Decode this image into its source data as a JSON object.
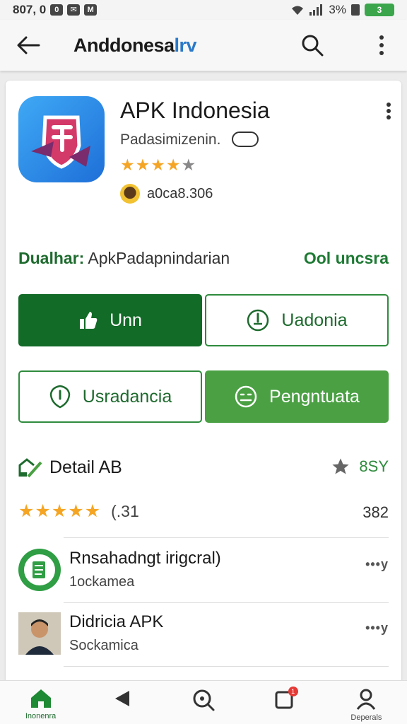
{
  "status_bar": {
    "time": "807, 0",
    "battery": "3%",
    "battery_pill": "3"
  },
  "app_bar": {
    "title_main": "Anddonesa",
    "title_accent": "lrv"
  },
  "app": {
    "name": "APK Indonesia",
    "developer": "Padasimizenin.",
    "rating_stars": 4,
    "downloads": "a0ca8.306"
  },
  "info": {
    "label_bold": "Dualhar:",
    "label_rest": "ApkPadapnindarian",
    "link": "Ool uncsra"
  },
  "buttons": [
    {
      "label": "Unn",
      "icon": "thumbs-up-icon"
    },
    {
      "label": "Uadonia",
      "icon": "download-circle-icon"
    },
    {
      "label": "Usradancia",
      "icon": "shield-icon"
    },
    {
      "label": "Pengntuata",
      "icon": "emoji-icon"
    }
  ],
  "details": {
    "title": "Detail AB",
    "right_label": "8SY",
    "rating_stars": 5,
    "rating_count": "(.31",
    "rating_right": "382"
  },
  "reviews": [
    {
      "name": "Rnsahadngt irigcral)",
      "sub": "1ockamea",
      "more": "•••y"
    },
    {
      "name": "Didricia APK",
      "sub": "Sockamica",
      "more": "•••y"
    }
  ],
  "bottom_nav": [
    {
      "label": "Inonenra",
      "icon": "home-icon"
    },
    {
      "label": "",
      "icon": "back-icon"
    },
    {
      "label": "",
      "icon": "search-icon"
    },
    {
      "label": "",
      "icon": "notifications-icon"
    },
    {
      "label": "Deperals",
      "icon": "profile-icon"
    }
  ],
  "colors": {
    "primary_green": "#126b27",
    "light_green": "#4aa043",
    "accent_blue": "#2a79c9",
    "star": "#f5a524"
  }
}
